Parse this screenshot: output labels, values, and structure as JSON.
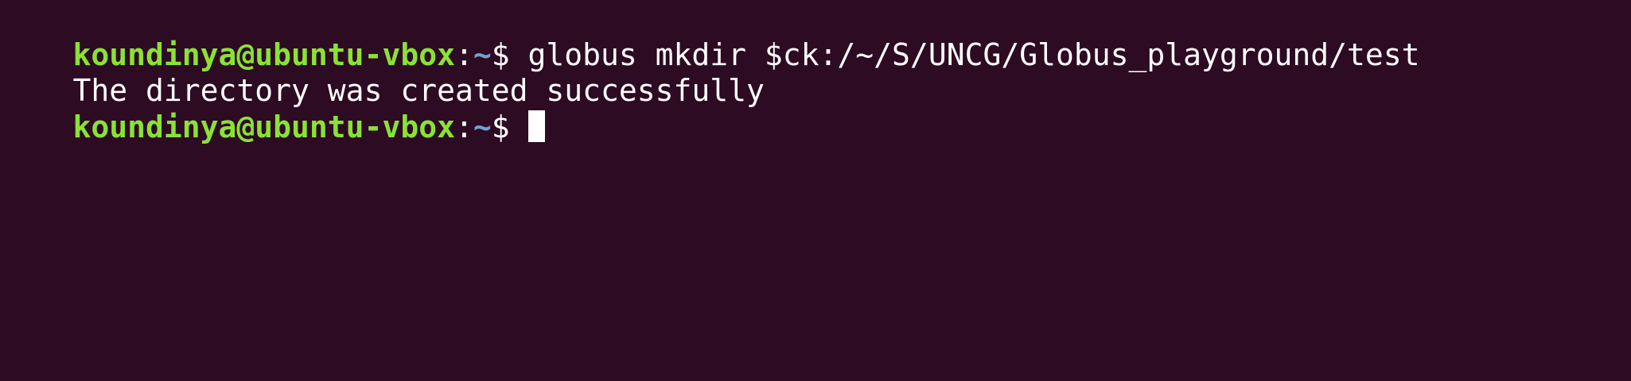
{
  "terminal": {
    "prompt": {
      "user_host": "koundinya@ubuntu-vbox",
      "colon": ":",
      "path": "~",
      "symbol": "$ "
    },
    "lines": [
      {
        "command": "globus mkdir $ck:/~/S/UNCG/Globus_playground/test"
      },
      {
        "output": "The directory was created successfully"
      },
      {
        "command": ""
      }
    ],
    "colors": {
      "background": "#2d0b22",
      "user_host": "#8ae234",
      "path": "#729fcf",
      "text": "#ffffff"
    }
  }
}
